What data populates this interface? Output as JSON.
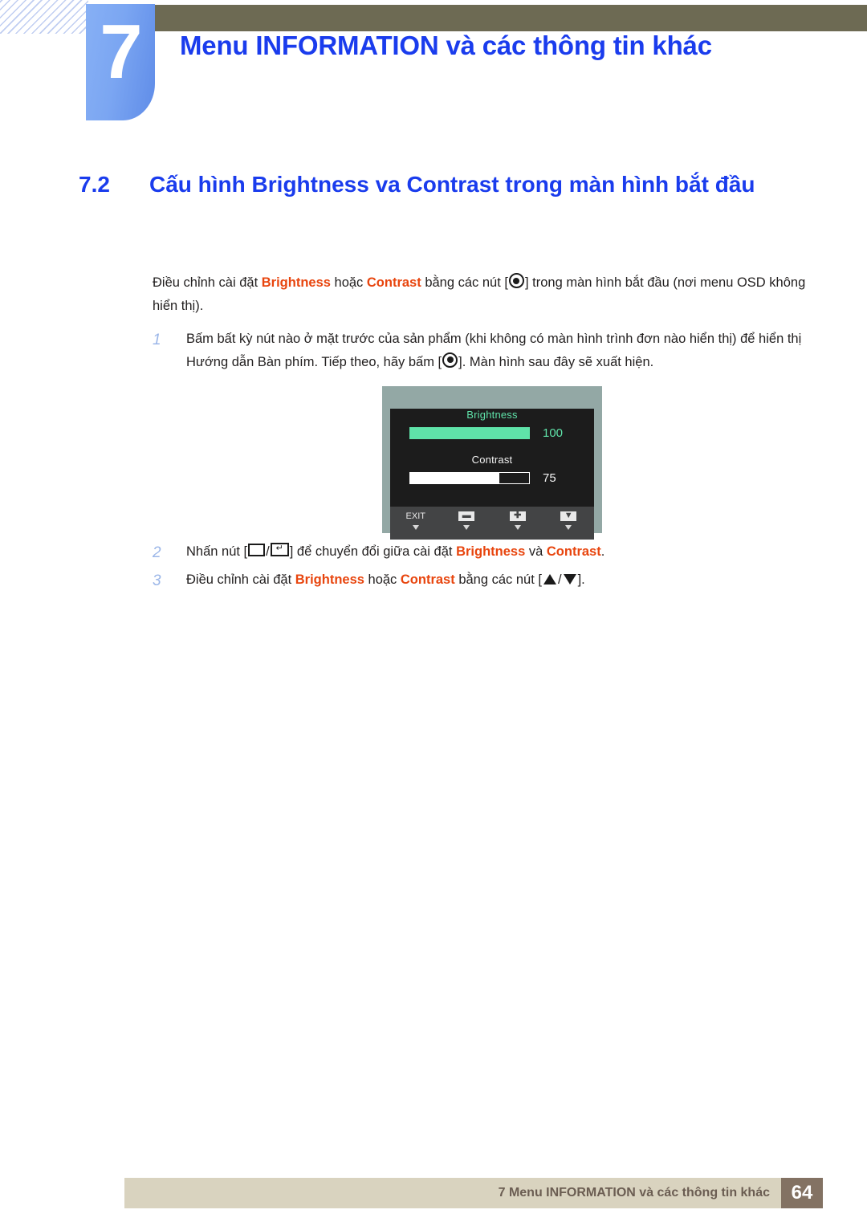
{
  "header": {
    "chapter_number": "7",
    "chapter_title": "Menu INFORMATION và các thông tin khác"
  },
  "section": {
    "number": "7.2",
    "title": "Cấu hình Brightness va Contrast trong màn hình bắt đầu"
  },
  "intro": {
    "part1": "Điều chỉnh cài đặt ",
    "kw1": "Brightness",
    "part2": " hoặc ",
    "kw2": "Contrast",
    "part3": " bằng các nút [",
    "part4": "] trong màn hình bắt đầu (nơi menu OSD không hiển thị)."
  },
  "steps": [
    {
      "number": "1",
      "part1": "Bấm bất kỳ nút nào ở mặt trước của sản phẩm (khi không có màn hình trình đơn nào hiển thị) để hiển thị Hướng dẫn Bàn phím. Tiếp theo, hãy bấm [",
      "part2": "]. Màn hình sau đây sẽ xuất hiện."
    },
    {
      "number": "2",
      "part1": "Nhấn nút [",
      "sep": "/",
      "part2": "] để chuyển đổi giữa cài đặt ",
      "kw1": "Brightness",
      "part3": " và ",
      "kw2": "Contrast",
      "part4": "."
    },
    {
      "number": "3",
      "part1": "Điều chỉnh cài đặt ",
      "kw1": "Brightness",
      "part2": " hoặc ",
      "kw2": "Contrast",
      "part3": " bằng các nút [",
      "sep": "/",
      "part4": "]."
    }
  ],
  "osd": {
    "brightness_label": "Brightness",
    "brightness_value": "100",
    "brightness_percent": 100,
    "contrast_label": "Contrast",
    "contrast_value": "75",
    "contrast_percent": 75,
    "buttons": [
      {
        "label": "EXIT",
        "type": "text"
      },
      {
        "label": "▬",
        "type": "key"
      },
      {
        "label": "✚",
        "type": "key"
      },
      {
        "label": "▼",
        "type": "key"
      }
    ],
    "colors": {
      "bezel": "#93a8a5",
      "screen": "#1c1c1c",
      "accent_green": "#5fe3a9",
      "buttonbar": "#434445"
    }
  },
  "footer": {
    "text": "7 Menu INFORMATION và các thông tin khác",
    "page_number": "64"
  },
  "colors": {
    "heading_blue": "#1a3ced",
    "keyword_orange": "#e8450e",
    "olive_bar": "#6d6a53",
    "footer_band": "#d9d3bf",
    "footer_page_box": "#837263"
  }
}
